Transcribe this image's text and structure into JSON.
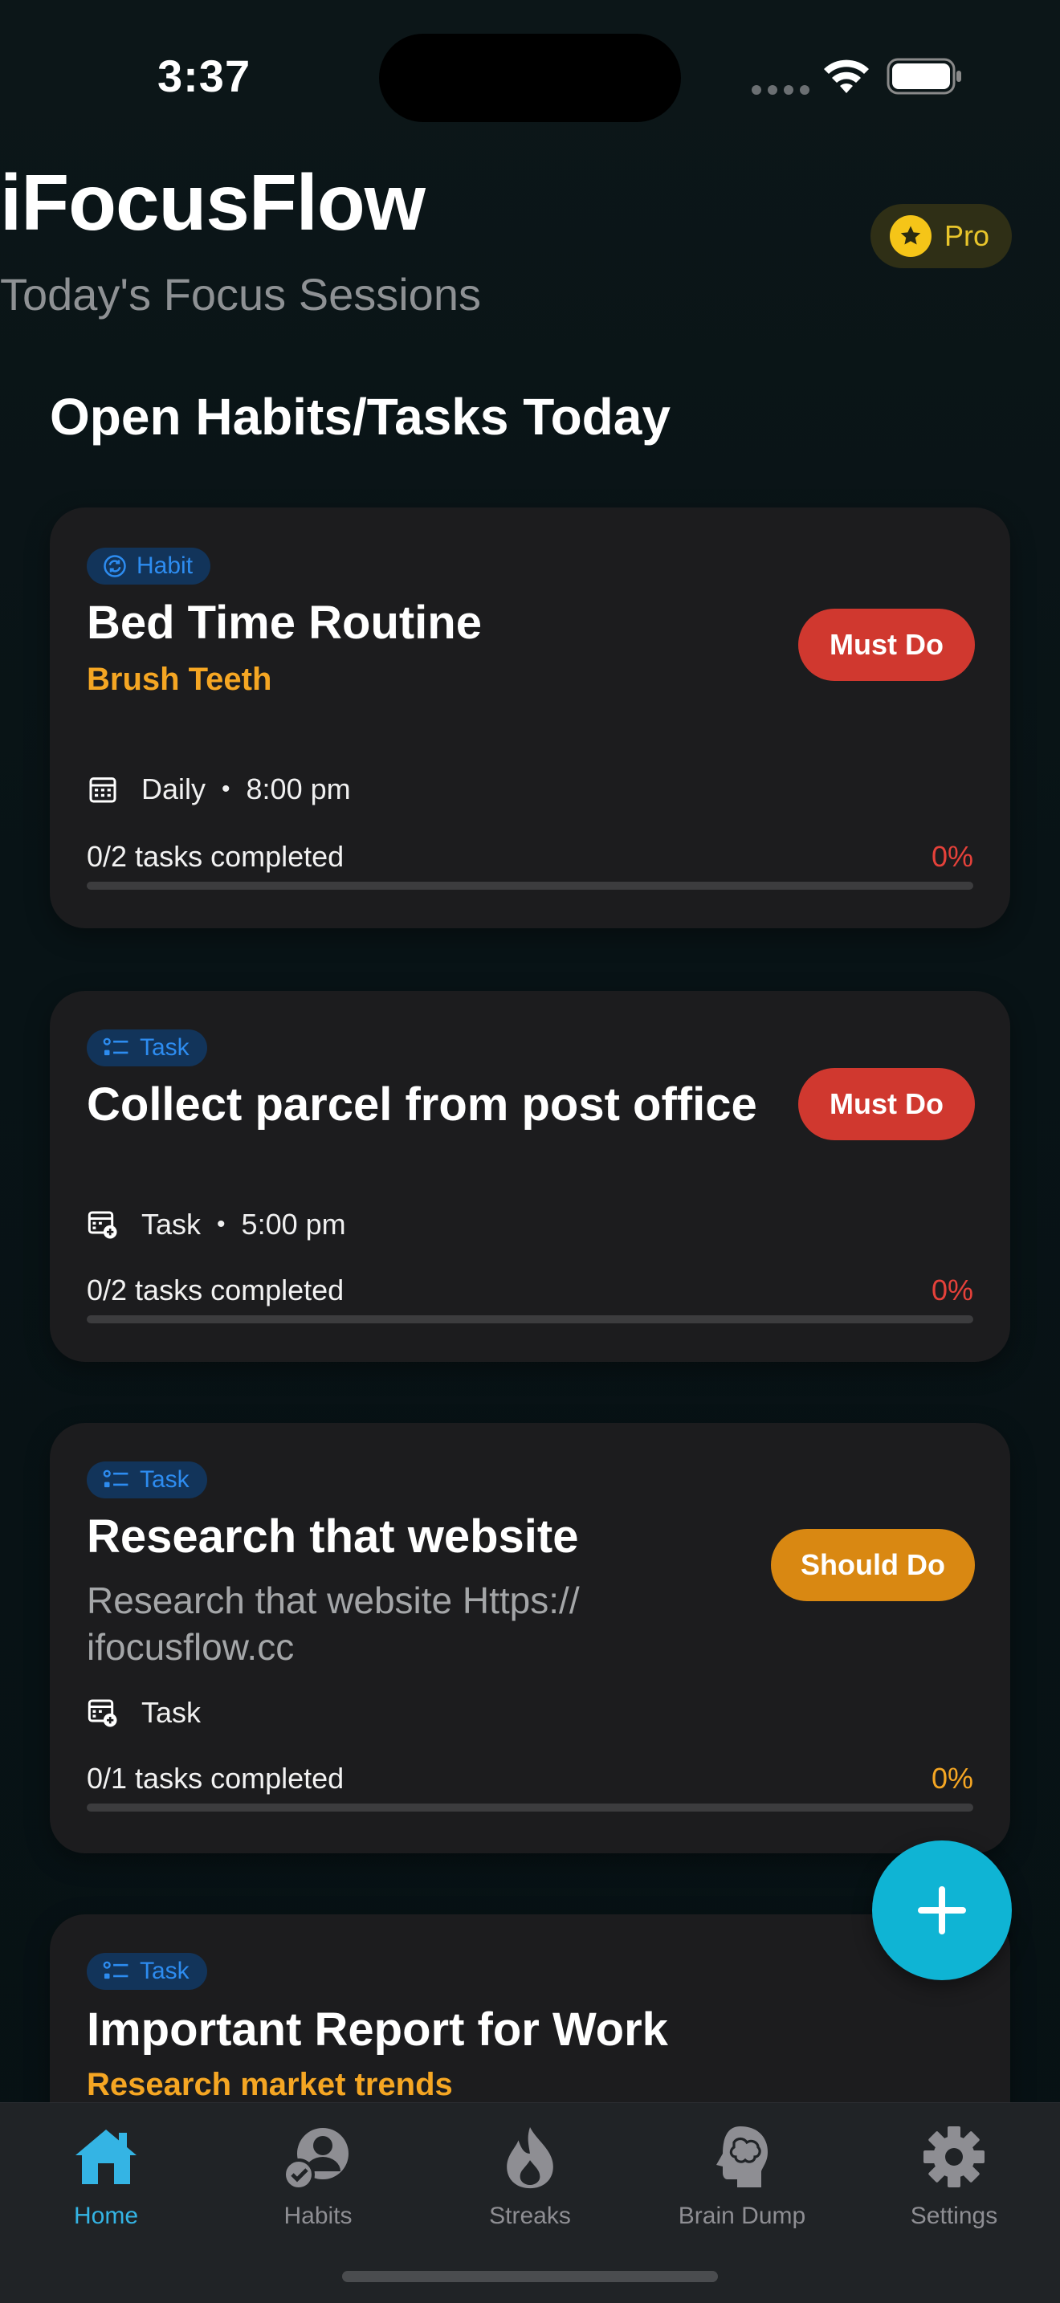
{
  "status_bar": {
    "time": "3:37"
  },
  "header": {
    "title": "iFocusFlow",
    "subtitle": "Today's Focus Sessions",
    "pro_label": "Pro"
  },
  "section_title": "Open Habits/Tasks Today",
  "cards": [
    {
      "tag": "Habit",
      "title": "Bed Time Routine",
      "subtitle": "Brush Teeth",
      "priority": "Must Do",
      "meta_type": "Daily",
      "meta_time": "8:00 pm",
      "progress_text": "0/2 tasks completed",
      "progress_pct": "0%",
      "progress_fraction": 0
    },
    {
      "tag": "Task",
      "title": "Collect parcel from post office",
      "priority": "Must Do",
      "meta_type": "Task",
      "meta_time": "5:00 pm",
      "progress_text": "0/2 tasks completed",
      "progress_pct": "0%",
      "progress_fraction": 0
    },
    {
      "tag": "Task",
      "title": "Research that website",
      "description": "Research that website Https:// ifocusflow.cc",
      "priority": "Should Do",
      "meta_type": "Task",
      "progress_text": "0/1 tasks completed",
      "progress_pct": "0%",
      "progress_fraction": 0
    },
    {
      "tag": "Task",
      "title": "Important Report for Work",
      "subtitle": "Research market trends"
    }
  ],
  "tab_bar": [
    {
      "label": "Home",
      "icon": "home-icon",
      "active": true
    },
    {
      "label": "Habits",
      "icon": "habits-person-check-icon",
      "active": false
    },
    {
      "label": "Streaks",
      "icon": "flame-icon",
      "active": false
    },
    {
      "label": "Brain Dump",
      "icon": "brain-head-icon",
      "active": false
    },
    {
      "label": "Settings",
      "icon": "gear-icon",
      "active": false
    }
  ],
  "colors": {
    "accent": "#34b4e4",
    "fab": "#0fb4d4",
    "must_do": "#d0382f",
    "should_do": "#d98812",
    "subtitle_orange": "#f5a623",
    "tag_blue": "#2d8cf0"
  }
}
